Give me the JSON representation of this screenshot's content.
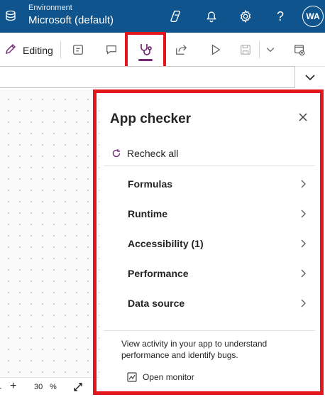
{
  "header": {
    "environment_label": "Environment",
    "environment_name": "Microsoft (default)",
    "avatar_initials": "WA",
    "icons": [
      "environment-icon",
      "copilot-icon",
      "bell-icon",
      "gear-icon",
      "help-icon"
    ]
  },
  "toolbar": {
    "editing_label": "Editing",
    "icons": [
      "pencil-icon",
      "comments-panel-icon",
      "chat-icon",
      "stethoscope-icon",
      "share-icon",
      "play-icon",
      "save-icon",
      "chevron-down-icon",
      "publish-icon"
    ],
    "active_icon": "stethoscope-icon",
    "accent_color": "#742774"
  },
  "zoom": {
    "minus": "-",
    "plus": "+",
    "value": "30",
    "unit": "%"
  },
  "app_checker": {
    "title": "App checker",
    "recheck_label": "Recheck all",
    "categories": [
      {
        "label": "Formulas"
      },
      {
        "label": "Runtime"
      },
      {
        "label": "Accessibility (1)"
      },
      {
        "label": "Performance"
      },
      {
        "label": "Data source"
      }
    ],
    "monitor_description": "View activity in your app to understand performance and identify bugs.",
    "monitor_link": "Open monitor"
  },
  "colors": {
    "header_bg": "#0f548c",
    "highlight": "#e3171b"
  }
}
